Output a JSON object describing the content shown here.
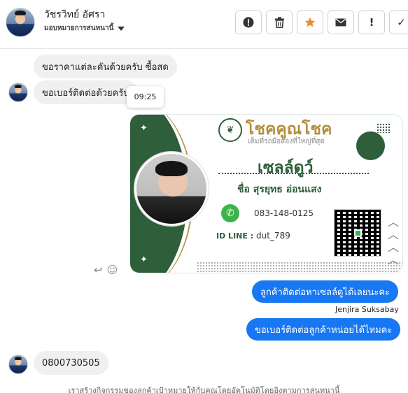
{
  "header": {
    "name": "วัชรวิทย์ อัศรา",
    "assign_label": "มอบหมายการสนทนานี้"
  },
  "toolbar": {
    "buttons": [
      {
        "icon": "alert-circle-icon",
        "glyph": "❗"
      },
      {
        "icon": "trash-icon",
        "glyph": "🗑"
      },
      {
        "icon": "star-icon",
        "glyph": "★",
        "color": "#f28b2c"
      },
      {
        "icon": "mail-icon",
        "glyph": "✉"
      },
      {
        "icon": "exclamation-icon",
        "glyph": "!"
      },
      {
        "icon": "check-icon",
        "glyph": "✓"
      }
    ]
  },
  "messages": {
    "in1": "ขอราคาแต่ละคันด้วยครับ ซื้อสด",
    "in2": "ขอเบอร์ติดต่อด้วยครับ",
    "tooltip_time": "09:25",
    "out1": "ลูกค้าติดต่อหาเซลล์ดูได้เลยนะคะ",
    "sender": "Jenjira Suksabay",
    "out2": "ขอเบอร์ติดต่อลูกค้าหน่อยได้ไหมคะ",
    "in3": "0800730505"
  },
  "card": {
    "brand": "โชคคูณโชค",
    "tagline": "เต็มที่รถมือสองที่ใหญ่ที่สุด",
    "sale_name": "เซลล์ดูว์",
    "full_name": "ชื่อ สุรยุทธ  อ่อนแสง",
    "phone": "083-148-0125",
    "id_line_label": "ID LINE :",
    "id_line_value": "dut_789"
  },
  "footer": "เราสร้างกิจกรรมของลูกค้าเป้าหมายให้กับคุณโดยอัตโนมัติโดยอิงตามการสนทนานี้",
  "colors": {
    "accent": "#1877f2",
    "card_green": "#2e5e3a",
    "brand_gold": "#b58e3a"
  }
}
